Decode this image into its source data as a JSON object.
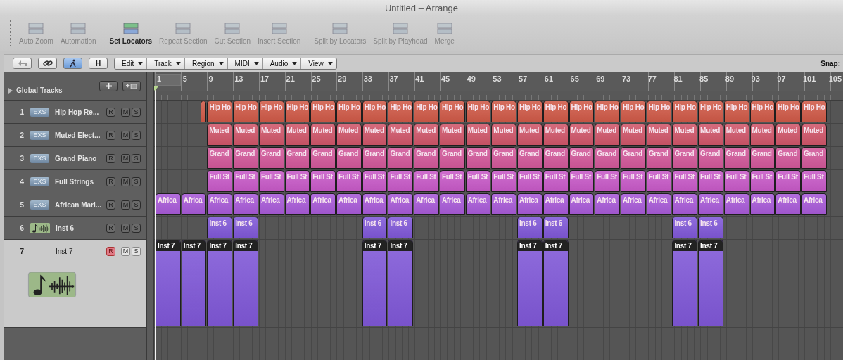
{
  "window": {
    "title": "Untitled – Arrange"
  },
  "toolbar": {
    "groups": [
      [
        {
          "label": "Auto Zoom",
          "disabled": true
        },
        {
          "label": "Automation",
          "disabled": true
        }
      ],
      [
        {
          "label": "Set Locators",
          "disabled": false
        },
        {
          "label": "Repeat Section",
          "disabled": true
        },
        {
          "label": "Cut Section",
          "disabled": true
        },
        {
          "label": "Insert Section",
          "disabled": true
        }
      ],
      [
        {
          "label": "Split by Locators",
          "disabled": true
        },
        {
          "label": "Split by Playhead",
          "disabled": true
        },
        {
          "label": "Merge",
          "disabled": true
        }
      ]
    ]
  },
  "arrange_header": {
    "buttons": [
      {
        "kind": "back",
        "on": false
      },
      {
        "kind": "link",
        "on": false
      },
      {
        "kind": "catch",
        "on": true
      },
      {
        "kind": "text",
        "label": "H",
        "on": false
      }
    ],
    "menus": [
      "Edit",
      "Track",
      "Region",
      "MIDI",
      "Audio",
      "View"
    ],
    "snap_label": "Snap:"
  },
  "global_tracks": {
    "label": "Global Tracks"
  },
  "ruler": {
    "labels": [
      "1",
      "5",
      "9",
      "13",
      "17",
      "21",
      "25",
      "29",
      "33",
      "37",
      "41",
      "45",
      "49",
      "53",
      "57",
      "61",
      "65",
      "69",
      "73",
      "77",
      "81",
      "85",
      "89",
      "93",
      "97",
      "101",
      "105"
    ]
  },
  "tracks": [
    {
      "number": "1",
      "kind": "exs",
      "badge": "EXS",
      "name": "Hip Hop Re...",
      "record_label": "R",
      "mute_label": "M",
      "solo_label": "S",
      "selected": false,
      "record": false,
      "color": "#d05a48",
      "regions_selected": false,
      "slots": [
        {
          "kind": "gap"
        },
        {
          "kind": "stub"
        },
        {
          "kind": "region",
          "label": "Hip Ho"
        },
        {
          "kind": "region",
          "label": "Hip Ho"
        },
        {
          "kind": "region",
          "label": "Hip Ho"
        },
        {
          "kind": "region",
          "label": "Hip Ho"
        },
        {
          "kind": "region",
          "label": "Hip Ho"
        },
        {
          "kind": "region",
          "label": "Hip Ho"
        },
        {
          "kind": "region",
          "label": "Hip Ho"
        },
        {
          "kind": "region",
          "label": "Hip Ho"
        },
        {
          "kind": "region",
          "label": "Hip Ho"
        },
        {
          "kind": "region",
          "label": "Hip Ho"
        },
        {
          "kind": "region",
          "label": "Hip Ho"
        },
        {
          "kind": "region",
          "label": "Hip Ho"
        },
        {
          "kind": "region",
          "label": "Hip Ho"
        },
        {
          "kind": "region",
          "label": "Hip Ho"
        },
        {
          "kind": "region",
          "label": "Hip Ho"
        },
        {
          "kind": "region",
          "label": "Hip Ho"
        },
        {
          "kind": "region",
          "label": "Hip Ho"
        },
        {
          "kind": "region",
          "label": "Hip Ho"
        },
        {
          "kind": "region",
          "label": "Hip Ho"
        },
        {
          "kind": "region",
          "label": "Hip Ho"
        },
        {
          "kind": "region",
          "label": "Hip Ho"
        },
        {
          "kind": "region",
          "label": "Hip Ho"
        },
        {
          "kind": "region",
          "label": "Hip Ho"
        },
        {
          "kind": "region",
          "label": "Hip Ho"
        }
      ]
    },
    {
      "number": "2",
      "kind": "exs",
      "badge": "EXS",
      "name": "Muted Elect...",
      "record_label": "R",
      "mute_label": "M",
      "solo_label": "S",
      "selected": false,
      "record": false,
      "color": "#d0566a",
      "regions_selected": false,
      "slots": [
        {
          "kind": "gap"
        },
        {
          "kind": "gap"
        },
        {
          "kind": "region",
          "label": "Muted"
        },
        {
          "kind": "region",
          "label": "Muted"
        },
        {
          "kind": "region",
          "label": "Muted"
        },
        {
          "kind": "region",
          "label": "Muted"
        },
        {
          "kind": "region",
          "label": "Muted"
        },
        {
          "kind": "region",
          "label": "Muted"
        },
        {
          "kind": "region",
          "label": "Muted"
        },
        {
          "kind": "region",
          "label": "Muted"
        },
        {
          "kind": "region",
          "label": "Muted"
        },
        {
          "kind": "region",
          "label": "Muted"
        },
        {
          "kind": "region",
          "label": "Muted"
        },
        {
          "kind": "region",
          "label": "Muted"
        },
        {
          "kind": "region",
          "label": "Muted"
        },
        {
          "kind": "region",
          "label": "Muted"
        },
        {
          "kind": "region",
          "label": "Muted"
        },
        {
          "kind": "region",
          "label": "Muted"
        },
        {
          "kind": "region",
          "label": "Muted"
        },
        {
          "kind": "region",
          "label": "Muted"
        },
        {
          "kind": "region",
          "label": "Muted"
        },
        {
          "kind": "region",
          "label": "Muted"
        },
        {
          "kind": "region",
          "label": "Muted"
        },
        {
          "kind": "region",
          "label": "Muted"
        },
        {
          "kind": "region",
          "label": "Muted"
        },
        {
          "kind": "region",
          "label": "Muted"
        }
      ]
    },
    {
      "number": "3",
      "kind": "exs",
      "badge": "EXS",
      "name": "Grand Piano",
      "record_label": "R",
      "mute_label": "M",
      "solo_label": "S",
      "selected": false,
      "record": false,
      "color": "#d2589a",
      "regions_selected": false,
      "slots": [
        {
          "kind": "gap"
        },
        {
          "kind": "gap"
        },
        {
          "kind": "region",
          "label": "Grand"
        },
        {
          "kind": "region",
          "label": "Grand"
        },
        {
          "kind": "region",
          "label": "Grand"
        },
        {
          "kind": "region",
          "label": "Grand"
        },
        {
          "kind": "region",
          "label": "Grand"
        },
        {
          "kind": "region",
          "label": "Grand"
        },
        {
          "kind": "region",
          "label": "Grand"
        },
        {
          "kind": "region",
          "label": "Grand"
        },
        {
          "kind": "region",
          "label": "Grand"
        },
        {
          "kind": "region",
          "label": "Grand"
        },
        {
          "kind": "region",
          "label": "Grand"
        },
        {
          "kind": "region",
          "label": "Grand"
        },
        {
          "kind": "region",
          "label": "Grand"
        },
        {
          "kind": "region",
          "label": "Grand"
        },
        {
          "kind": "region",
          "label": "Grand"
        },
        {
          "kind": "region",
          "label": "Grand"
        },
        {
          "kind": "region",
          "label": "Grand"
        },
        {
          "kind": "region",
          "label": "Grand"
        },
        {
          "kind": "region",
          "label": "Grand"
        },
        {
          "kind": "region",
          "label": "Grand"
        },
        {
          "kind": "region",
          "label": "Grand"
        },
        {
          "kind": "region",
          "label": "Grand"
        },
        {
          "kind": "region",
          "label": "Grand"
        },
        {
          "kind": "region",
          "label": "Grand"
        }
      ]
    },
    {
      "number": "4",
      "kind": "exs",
      "badge": "EXS",
      "name": "Full Strings",
      "record_label": "R",
      "mute_label": "M",
      "solo_label": "S",
      "selected": false,
      "record": false,
      "color": "#c85ac8",
      "regions_selected": false,
      "slots": [
        {
          "kind": "gap"
        },
        {
          "kind": "gap"
        },
        {
          "kind": "region",
          "label": "Full St"
        },
        {
          "kind": "region",
          "label": "Full St"
        },
        {
          "kind": "region",
          "label": "Full St"
        },
        {
          "kind": "region",
          "label": "Full St"
        },
        {
          "kind": "region",
          "label": "Full St"
        },
        {
          "kind": "region",
          "label": "Full St"
        },
        {
          "kind": "region",
          "label": "Full St"
        },
        {
          "kind": "region",
          "label": "Full St"
        },
        {
          "kind": "region",
          "label": "Full St"
        },
        {
          "kind": "region",
          "label": "Full St"
        },
        {
          "kind": "region",
          "label": "Full St"
        },
        {
          "kind": "region",
          "label": "Full St"
        },
        {
          "kind": "region",
          "label": "Full St"
        },
        {
          "kind": "region",
          "label": "Full St"
        },
        {
          "kind": "region",
          "label": "Full St"
        },
        {
          "kind": "region",
          "label": "Full St"
        },
        {
          "kind": "region",
          "label": "Full St"
        },
        {
          "kind": "region",
          "label": "Full St"
        },
        {
          "kind": "region",
          "label": "Full St"
        },
        {
          "kind": "region",
          "label": "Full St"
        },
        {
          "kind": "region",
          "label": "Full St"
        },
        {
          "kind": "region",
          "label": "Full St"
        },
        {
          "kind": "region",
          "label": "Full St"
        },
        {
          "kind": "region",
          "label": "Full St"
        }
      ]
    },
    {
      "number": "5",
      "kind": "exs",
      "badge": "EXS",
      "name": "African Mari...",
      "record_label": "R",
      "mute_label": "M",
      "solo_label": "S",
      "selected": false,
      "record": false,
      "color": "#a85ad8",
      "regions_selected": false,
      "slots": [
        {
          "kind": "region",
          "label": "Africa"
        },
        {
          "kind": "region",
          "label": "Africa"
        },
        {
          "kind": "region",
          "label": "Africa"
        },
        {
          "kind": "region",
          "label": "Africa"
        },
        {
          "kind": "region",
          "label": "Africa"
        },
        {
          "kind": "region",
          "label": "Africa"
        },
        {
          "kind": "region",
          "label": "Africa"
        },
        {
          "kind": "region",
          "label": "Africa"
        },
        {
          "kind": "region",
          "label": "Africa"
        },
        {
          "kind": "region",
          "label": "Africa"
        },
        {
          "kind": "region",
          "label": "Africa"
        },
        {
          "kind": "region",
          "label": "Africa"
        },
        {
          "kind": "region",
          "label": "Africa"
        },
        {
          "kind": "region",
          "label": "Africa"
        },
        {
          "kind": "region",
          "label": "Africa"
        },
        {
          "kind": "region",
          "label": "Africa"
        },
        {
          "kind": "region",
          "label": "Africa"
        },
        {
          "kind": "region",
          "label": "Africa"
        },
        {
          "kind": "region",
          "label": "Africa"
        },
        {
          "kind": "region",
          "label": "Africa"
        },
        {
          "kind": "region",
          "label": "Africa"
        },
        {
          "kind": "region",
          "label": "Africa"
        },
        {
          "kind": "region",
          "label": "Africa"
        },
        {
          "kind": "region",
          "label": "Africa"
        },
        {
          "kind": "region",
          "label": "Africa"
        },
        {
          "kind": "region",
          "label": "Africa"
        }
      ]
    },
    {
      "number": "6",
      "kind": "instrument",
      "name": "Inst 6",
      "record_label": "R",
      "mute_label": "M",
      "solo_label": "S",
      "selected": false,
      "record": false,
      "color": "#8058d8",
      "regions_selected": false,
      "slots": [
        {
          "kind": "gap"
        },
        {
          "kind": "gap"
        },
        {
          "kind": "region",
          "label": "Inst 6"
        },
        {
          "kind": "region",
          "label": "Inst 6"
        },
        {
          "kind": "gap"
        },
        {
          "kind": "gap"
        },
        {
          "kind": "gap"
        },
        {
          "kind": "gap"
        },
        {
          "kind": "region",
          "label": "Inst 6"
        },
        {
          "kind": "region",
          "label": "Inst 6"
        },
        {
          "kind": "gap"
        },
        {
          "kind": "gap"
        },
        {
          "kind": "gap"
        },
        {
          "kind": "gap"
        },
        {
          "kind": "region",
          "label": "Inst 6"
        },
        {
          "kind": "region",
          "label": "Inst 6"
        },
        {
          "kind": "gap"
        },
        {
          "kind": "gap"
        },
        {
          "kind": "gap"
        },
        {
          "kind": "gap"
        },
        {
          "kind": "region",
          "label": "Inst 6"
        },
        {
          "kind": "region",
          "label": "Inst 6"
        }
      ]
    },
    {
      "number": "7",
      "kind": "instrument",
      "name": "Inst 7",
      "record_label": "R",
      "mute_label": "M",
      "solo_label": "S",
      "selected": true,
      "record": true,
      "color": "#8058d8",
      "regions_selected": true,
      "slots": [
        {
          "kind": "region",
          "label": "Inst 7"
        },
        {
          "kind": "region",
          "label": "Inst 7"
        },
        {
          "kind": "region",
          "label": "Inst 7"
        },
        {
          "kind": "region",
          "label": "Inst 7"
        },
        {
          "kind": "gap"
        },
        {
          "kind": "gap"
        },
        {
          "kind": "gap"
        },
        {
          "kind": "gap"
        },
        {
          "kind": "region",
          "label": "Inst 7"
        },
        {
          "kind": "region",
          "label": "Inst 7"
        },
        {
          "kind": "gap"
        },
        {
          "kind": "gap"
        },
        {
          "kind": "gap"
        },
        {
          "kind": "gap"
        },
        {
          "kind": "region",
          "label": "Inst 7"
        },
        {
          "kind": "region",
          "label": "Inst 7"
        },
        {
          "kind": "gap"
        },
        {
          "kind": "gap"
        },
        {
          "kind": "gap"
        },
        {
          "kind": "gap"
        },
        {
          "kind": "region",
          "label": "Inst 7"
        },
        {
          "kind": "region",
          "label": "Inst 7"
        }
      ]
    }
  ]
}
